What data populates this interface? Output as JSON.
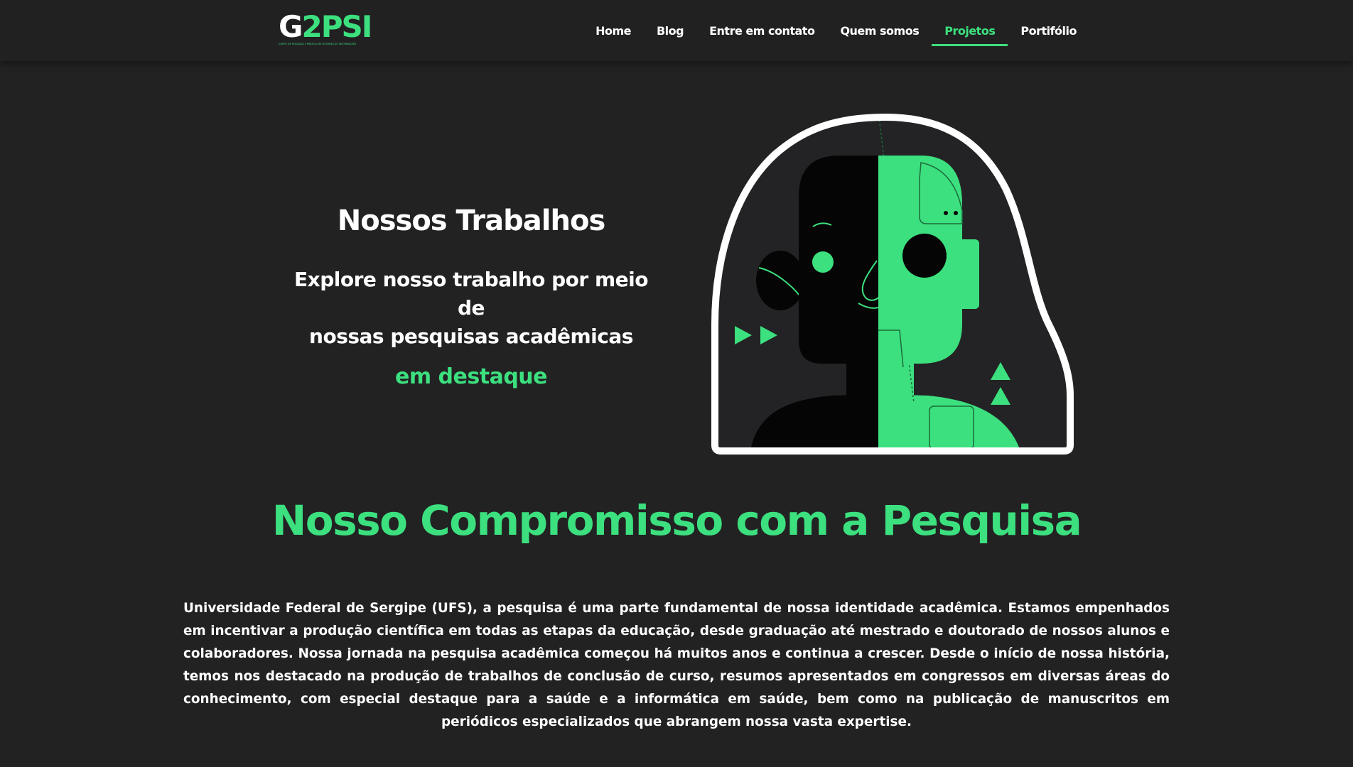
{
  "brand": {
    "logo_g": "G",
    "logo_2": "2",
    "logo_psi": "PSI",
    "tagline": "GRUPO DE PESQUISA E PRÁTICA EM SISTEMAS DE INFORMAÇÕES"
  },
  "nav": {
    "items": [
      {
        "label": "Home",
        "active": false
      },
      {
        "label": "Blog",
        "active": false
      },
      {
        "label": "Entre em contato",
        "active": false
      },
      {
        "label": "Quem somos",
        "active": false
      },
      {
        "label": "Projetos",
        "active": true
      },
      {
        "label": "Portifólio",
        "active": false
      }
    ]
  },
  "hero": {
    "title": "Nossos Trabalhos",
    "subtitle_line1": "Explore nosso trabalho por meio de",
    "subtitle_line2": "nossas pesquisas acadêmicas",
    "highlight": "em destaque"
  },
  "commitment": {
    "title": "Nosso Compromisso com a Pesquisa",
    "body": "Universidade Federal de Sergipe (UFS), a pesquisa é uma parte fundamental de nossa identidade acadêmica. Estamos empenhados em incentivar a produção científica em todas as etapas da educação, desde graduação até mestrado e doutorado de nossos alunos e colaboradores. Nossa jornada na pesquisa acadêmica começou há muitos anos e continua a crescer. Desde o início de nossa história, temos nos destacado na produção de trabalhos de conclusão de curso, resumos apresentados em congressos em diversas áreas do conhecimento, com especial destaque para a saúde e a informática em saúde, bem como na publicação de manuscritos em periódicos especializados que abrangem nossa vasta expertise."
  },
  "colors": {
    "background": "#222223",
    "navbar": "#212122",
    "accent": "#3ce07e",
    "text": "#ffffff"
  }
}
